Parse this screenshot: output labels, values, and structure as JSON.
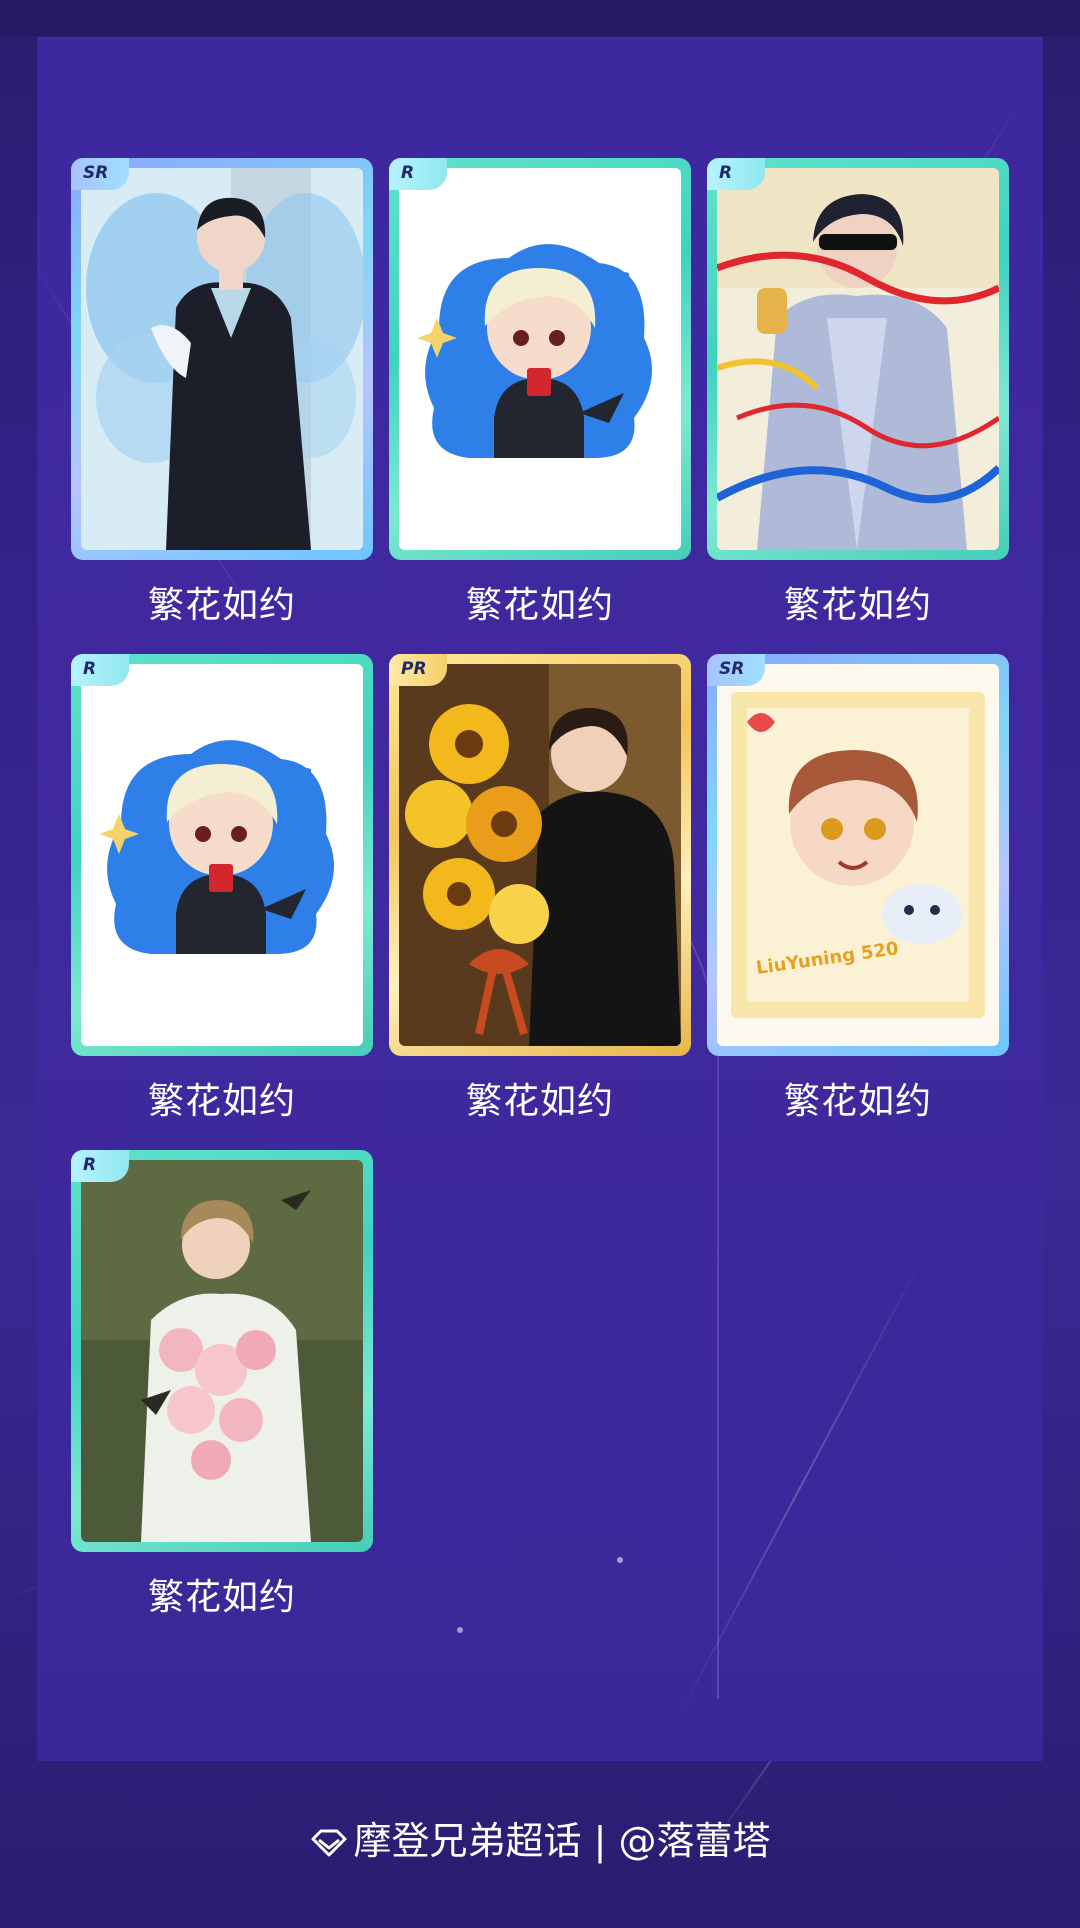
{
  "cards": [
    {
      "rarity": "SR",
      "name": "繁花如约",
      "art_icon": "man-in-suit-with-butterfly-wings"
    },
    {
      "rarity": "R",
      "name": "繁花如约",
      "art_icon": "chibi-blond-vampire"
    },
    {
      "rarity": "R",
      "name": "繁花如约",
      "art_icon": "man-blindfold-silver-jacket-ribbons"
    },
    {
      "rarity": "R",
      "name": "繁花如约",
      "art_icon": "chibi-blond-vampire"
    },
    {
      "rarity": "PR",
      "name": "繁花如约",
      "art_icon": "man-holding-sunflower-bouquet"
    },
    {
      "rarity": "SR",
      "name": "繁花如约",
      "art_icon": "chibi-boy-with-dog"
    },
    {
      "rarity": "R",
      "name": "繁花如约",
      "art_icon": "man-with-pink-flowers-and-birds"
    }
  ],
  "chibi_signature": "LiuYuning 520",
  "footer": {
    "icon": "diamond-icon",
    "text": "摩登兄弟超话 | @落蕾塔"
  },
  "colors": {
    "background": "#33228a",
    "panel": "#3d28a0",
    "frame_r": "#4fdcc5",
    "frame_sr": "#8fb8ff",
    "frame_pr": "#f3c55b"
  }
}
